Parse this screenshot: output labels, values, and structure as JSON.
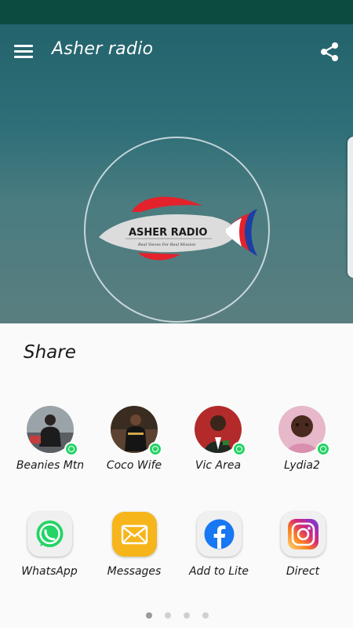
{
  "app_bar": {
    "title": "Asher radio",
    "menu_icon": "hamburger-menu-icon",
    "share_icon": "share-icon"
  },
  "station_logo": {
    "name": "ASHER RADIO",
    "tagline": "Real Voices For Real Mission",
    "colors": {
      "red": "#e3222b",
      "blue": "#1b3fa3",
      "body": "#d9d9d9"
    }
  },
  "share_sheet": {
    "title": "Share",
    "contacts": [
      {
        "label": "Beanies Mtn",
        "badge": "whatsapp-badge-icon"
      },
      {
        "label": "Coco Wife",
        "badge": "whatsapp-badge-icon"
      },
      {
        "label": "Vic Area",
        "badge": "whatsapp-badge-icon"
      },
      {
        "label": "Lydia2",
        "badge": "whatsapp-badge-icon"
      }
    ],
    "apps": [
      {
        "label": "WhatsApp",
        "icon": "whatsapp-icon"
      },
      {
        "label": "Messages",
        "icon": "messages-envelope-icon"
      },
      {
        "label": "Add to Lite",
        "icon": "facebook-icon"
      },
      {
        "label": "Direct",
        "icon": "instagram-icon"
      }
    ],
    "pager": {
      "pages": 4,
      "current": 1
    }
  },
  "colors": {
    "status_bar": "#0b4c3f",
    "header_bg": "#23636c",
    "whatsapp_green": "#25d366"
  }
}
